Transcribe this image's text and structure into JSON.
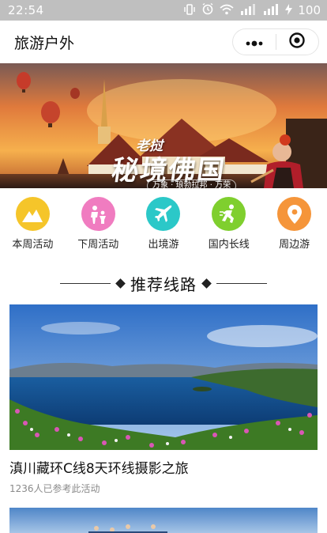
{
  "status_bar": {
    "time": "22:54",
    "battery": "100",
    "icons": [
      "vibrate-icon",
      "alarm-icon",
      "wifi-icon",
      "signal-4g-icon",
      "signal-icon",
      "charging-icon"
    ]
  },
  "nav": {
    "title": "旅游户外",
    "menu_icon": "more-dots-icon",
    "close_icon": "target-close-icon"
  },
  "banner": {
    "kicker": "老挝",
    "title": "秘境佛国",
    "subtitle": "万象 · 琅勃拉邦 · 万荣"
  },
  "categories": [
    {
      "label": "本周活动",
      "icon": "mountain-icon",
      "color": "#F5C52A"
    },
    {
      "label": "下周活动",
      "icon": "family-icon",
      "color": "#F07CC0"
    },
    {
      "label": "出境游",
      "icon": "airplane-icon",
      "color": "#2BC8C8"
    },
    {
      "label": "国内长线",
      "icon": "runner-icon",
      "color": "#7FCF2E"
    },
    {
      "label": "周边游",
      "icon": "location-pin-icon",
      "color": "#F5953A"
    }
  ],
  "section": {
    "title": "推荐线路"
  },
  "routes": [
    {
      "title": "滇川藏环C线8天环线摄影之旅",
      "meta": "1236人已参考此活动"
    }
  ],
  "colors": {
    "status_bar_bg": "#BFBFBF",
    "text_primary": "#111111",
    "text_secondary": "#8A8A8A"
  }
}
